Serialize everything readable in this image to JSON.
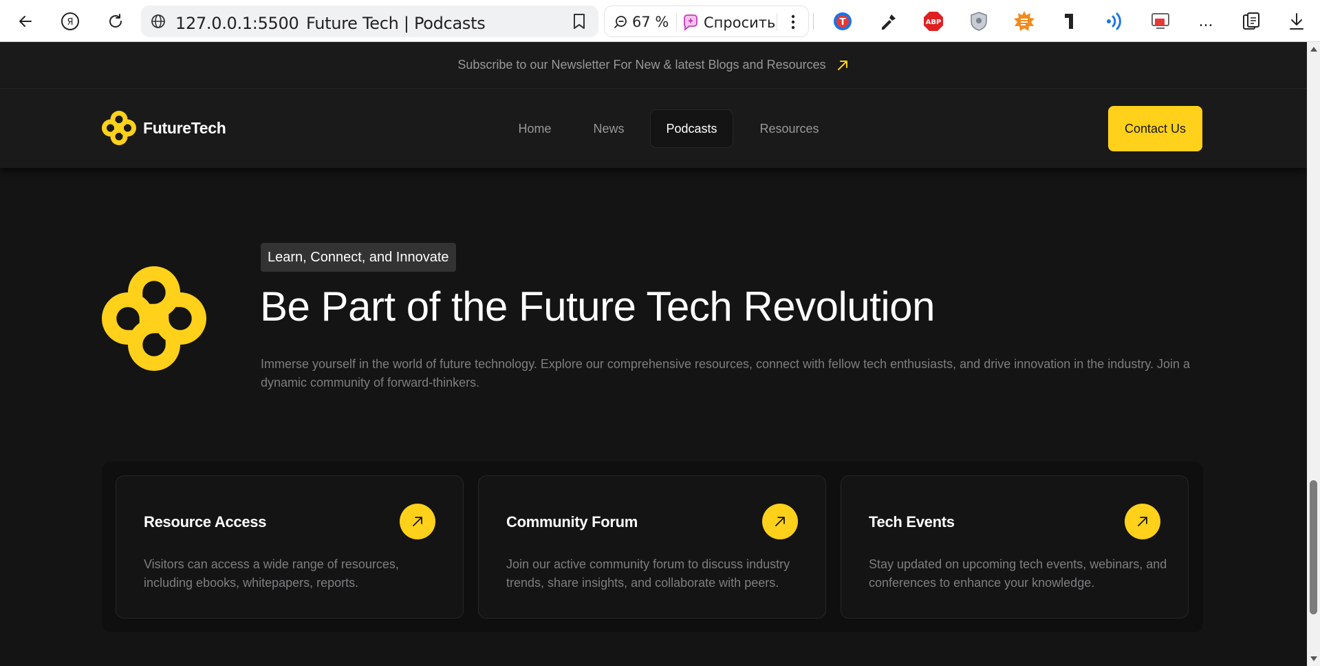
{
  "browser": {
    "url": "127.0.0.1:5500",
    "tab_title": "Future Tech | Podcasts",
    "zoom": "67 %",
    "ask_label": "Спросить",
    "more_label": "...",
    "extensions": [
      "translate-extension",
      "color-picker-extension",
      "adblock-plus-extension",
      "shield-extension",
      "sun-extension",
      "telegraph-extension",
      "wireless-extension",
      "screen-extension"
    ]
  },
  "newsletter": {
    "text": "Subscribe to our Newsletter For New & latest Blogs and Resources"
  },
  "nav": {
    "brand": "FutureTech",
    "links": [
      "Home",
      "News",
      "Podcasts",
      "Resources"
    ],
    "active": "Podcasts",
    "contact_label": "Contact Us"
  },
  "hero": {
    "tagline": "Learn, Connect, and Innovate",
    "title": "Be Part of the Future Tech Revolution",
    "description": "Immerse yourself in the world of future technology. Explore our comprehensive resources, connect with fellow tech enthusiasts, and drive innovation in the industry. Join a dynamic community of forward-thinkers."
  },
  "features": [
    {
      "title": "Resource Access",
      "description": "Visitors can access a wide range of resources, including ebooks, whitepapers, reports."
    },
    {
      "title": "Community Forum",
      "description": "Join our active community forum to discuss industry trends, share insights, and collaborate with peers."
    },
    {
      "title": "Tech Events",
      "description": "Stay updated on upcoming tech events, webinars, and conferences to enhance your knowledge."
    }
  ],
  "colors": {
    "accent": "#ffd11a",
    "background": "#141414",
    "nav_background": "#1a1a1a",
    "muted_text": "#98989a"
  }
}
